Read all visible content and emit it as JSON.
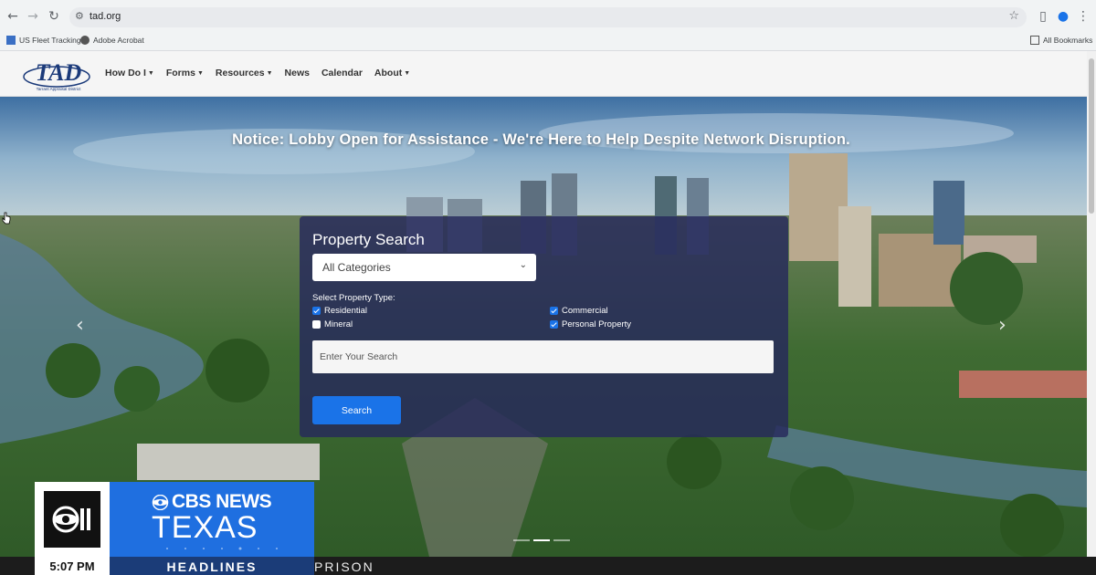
{
  "browser": {
    "url": "tad.org",
    "bookmarks": [
      "US Fleet Tracking",
      "Adobe Acrobat"
    ],
    "all_bookmarks": "All Bookmarks"
  },
  "site": {
    "logo_text": "TAD",
    "logo_subtext": "Tarrant Appraisal District",
    "nav": [
      "How Do I",
      "Forms",
      "Resources",
      "News",
      "Calendar",
      "About"
    ]
  },
  "hero": {
    "notice": "Notice: Lobby Open for Assistance - We're Here to Help Despite Network Disruption."
  },
  "search": {
    "title": "Property Search",
    "category": "All Categories",
    "type_label": "Select Property Type:",
    "types": [
      {
        "label": "Residential",
        "checked": true
      },
      {
        "label": "Commercial",
        "checked": true
      },
      {
        "label": "Mineral",
        "checked": false
      },
      {
        "label": "Personal Property",
        "checked": true
      }
    ],
    "placeholder": "Enter Your Search",
    "button": "Search"
  },
  "overlay": {
    "station": "CBS NEWS",
    "region": "TEXAS",
    "time": "5:07 PM",
    "segment": "HEADLINES",
    "ticker": "PRISON"
  },
  "colors": {
    "primary_blue": "#1a73e8",
    "panel": "#26285c",
    "cbs_blue": "#1f6fe0"
  }
}
